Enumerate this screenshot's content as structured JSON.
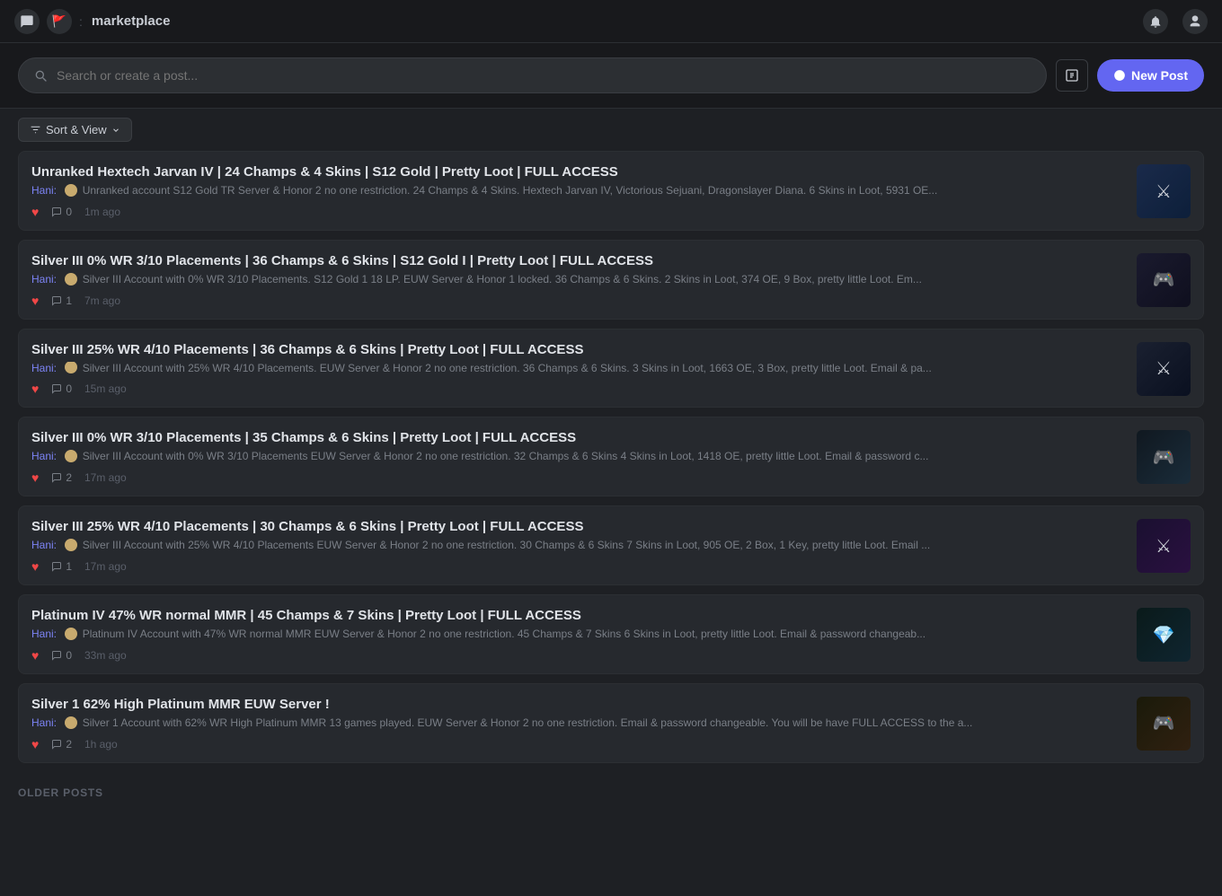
{
  "nav": {
    "title": "marketplace",
    "bell_icon": "🔔",
    "user_icon": "👤"
  },
  "searchbar": {
    "placeholder": "Search or create a post...",
    "new_post_label": "New Post"
  },
  "sort": {
    "label": "Sort & View"
  },
  "posts": [
    {
      "id": 1,
      "title": "Unranked Hextech Jarvan IV | 24 Champs & 4 Skins | S12 Gold | Pretty Loot | FULL ACCESS",
      "author": "Hani",
      "meta": "Unranked account S12 Gold  TR Server & Honor 2 no one restriction.  24 Champs & 4 Skins.  Hextech Jarvan IV, Victorious Sejuani, Dragonslayer Diana.  6 Skins in Loot, 5931 OE...",
      "likes": "",
      "comments": "0",
      "time": "1m ago",
      "thumb_class": "thumb-1",
      "thumb_char": "⚔"
    },
    {
      "id": 2,
      "title": "Silver III 0% WR 3/10 Placements | 36 Champs & 6 Skins | S12 Gold I | Pretty Loot | FULL ACCESS",
      "author": "Hani",
      "meta": "Silver III Account with 0% WR 3/10 Placements.  S12 Gold 1 18 LP.  EUW Server & Honor 1 locked.  36 Champs & 6 Skins.  2 Skins in Loot, 374 OE, 9 Box, pretty little Loot.  Em...",
      "likes": "",
      "comments": "1",
      "time": "7m ago",
      "thumb_class": "thumb-2",
      "thumb_char": "🎮"
    },
    {
      "id": 3,
      "title": "Silver III 25% WR 4/10 Placements | 36 Champs & 6 Skins | Pretty Loot | FULL ACCESS",
      "author": "Hani",
      "meta": "Silver III Account with 25% WR 4/10 Placements.  EUW Server & Honor 2 no one restriction.  36 Champs & 6 Skins.  3 Skins in Loot, 1663 OE, 3 Box, pretty little Loot.  Email & pa...",
      "likes": "",
      "comments": "0",
      "time": "15m ago",
      "thumb_class": "thumb-3",
      "thumb_char": "⚔"
    },
    {
      "id": 4,
      "title": "Silver III 0% WR 3/10 Placements | 35 Champs & 6 Skins | Pretty Loot | FULL ACCESS",
      "author": "Hani",
      "meta": "Silver III Account with 0% WR 3/10 Placements  EUW Server & Honor 2 no one restriction.  32 Champs & 6 Skins  4 Skins in Loot, 1418 OE, pretty little Loot.  Email & password c...",
      "likes": "",
      "comments": "2",
      "time": "17m ago",
      "thumb_class": "thumb-4",
      "thumb_char": "🎮"
    },
    {
      "id": 5,
      "title": "Silver III 25% WR 4/10 Placements | 30 Champs & 6 Skins | Pretty Loot | FULL ACCESS",
      "author": "Hani",
      "meta": "Silver III Account with 25% WR 4/10 Placements  EUW Server & Honor 2 no one restriction.  30 Champs & 6 Skins  7 Skins in Loot, 905 OE, 2 Box, 1 Key, pretty little Loot.  Email ...",
      "likes": "",
      "comments": "1",
      "time": "17m ago",
      "thumb_class": "thumb-5",
      "thumb_char": "⚔"
    },
    {
      "id": 6,
      "title": "Platinum IV 47% WR normal MMR | 45 Champs & 7 Skins | Pretty Loot | FULL ACCESS",
      "author": "Hani",
      "meta": "Platinum IV Account with 47% WR normal MMR  EUW Server & Honor 2 no one restriction.  45 Champs & 7 Skins  6 Skins in Loot, pretty little Loot.  Email & password changeab...",
      "likes": "",
      "comments": "0",
      "time": "33m ago",
      "thumb_class": "thumb-6",
      "thumb_char": "💎"
    },
    {
      "id": 7,
      "title": "Silver 1 62% High Platinum MMR EUW Server !",
      "author": "Hani",
      "meta": "Silver 1 Account with 62% WR High Platinum MMR 13 games played.  EUW Server & Honor 2 no one restriction.  Email & password changeable. You will be have FULL ACCESS to the a...",
      "likes": "",
      "comments": "2",
      "time": "1h ago",
      "thumb_class": "thumb-7",
      "thumb_char": "🎮"
    }
  ],
  "older_posts_label": "OLDER POSTS"
}
